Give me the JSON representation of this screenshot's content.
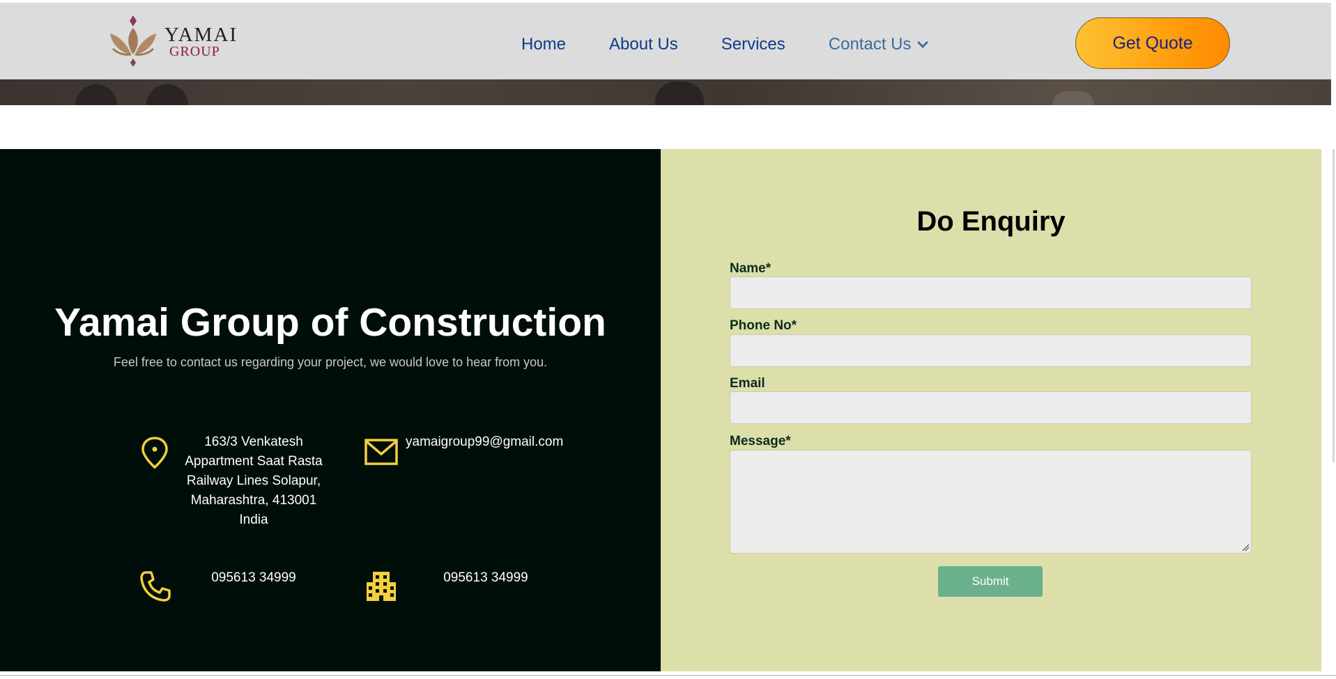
{
  "logo": {
    "line1": "YAMAI",
    "line2": "GROUP"
  },
  "nav": {
    "items": [
      {
        "label": "Home"
      },
      {
        "label": "About Us"
      },
      {
        "label": "Services"
      },
      {
        "label": "Contact Us"
      }
    ],
    "quote_button": "Get Quote"
  },
  "contact": {
    "title": "Yamai Group of Construction",
    "subtitle": "Feel free to contact us regarding your project, we would love to hear from you.",
    "address_lines": [
      "163/3 Venkatesh",
      "Appartment Saat Rasta",
      "Railway Lines Solapur,",
      "Maharashtra, 413001",
      "India"
    ],
    "email": "yamaigroup99@gmail.com",
    "phone": "095613 34999",
    "office_phone": "095613 34999"
  },
  "form": {
    "title": "Do Enquiry",
    "name_label": "Name*",
    "phone_label": "Phone No*",
    "email_label": "Email",
    "message_label": "Message*",
    "name_value": "",
    "phone_value": "",
    "email_value": "",
    "message_value": "",
    "submit_label": "Submit"
  },
  "colors": {
    "header_bg": "#dcdcdc",
    "left_bg": "#000e0a",
    "right_bg": "#dcdfaa",
    "icon_yellow": "#f2cf3c",
    "submit_bg": "#6bb08c",
    "nav_link": "#0d3b8a"
  },
  "icons": {
    "location": "map-pin-icon",
    "email": "envelope-icon",
    "phone": "phone-icon",
    "office": "building-icon",
    "dropdown": "chevron-down-icon"
  }
}
